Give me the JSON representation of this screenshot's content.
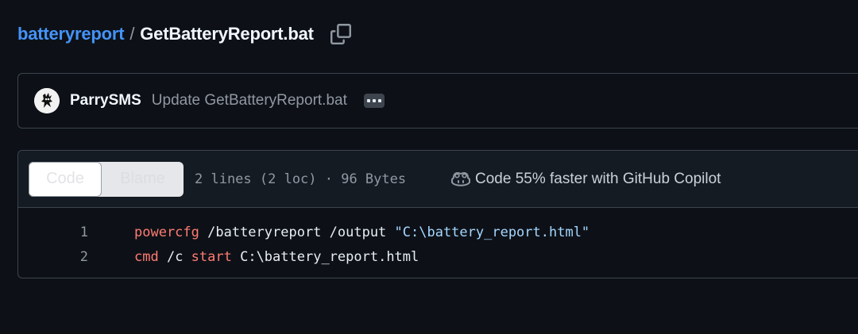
{
  "breadcrumb": {
    "repo": "batteryreport",
    "separator": "/",
    "file": "GetBatteryReport.bat",
    "copy_icon": "copy-icon"
  },
  "commit": {
    "author": "ParrySMS",
    "message": "Update GetBatteryReport.bat",
    "more_icon": "kebab-horizontal-icon"
  },
  "file_header": {
    "tabs": [
      "Code",
      "Blame"
    ],
    "active_tab": "Code",
    "info": "2 lines (2 loc) · 96 Bytes",
    "copilot_text": "Code 55% faster with GitHub Copilot",
    "copilot_icon": "copilot-icon"
  },
  "code": {
    "lines": [
      {
        "number": "1",
        "tokens": [
          {
            "text": "powercfg",
            "type": "kw"
          },
          {
            "text": " /batteryreport /output ",
            "type": "txt"
          },
          {
            "text": "\"C:\\battery_report.html\"",
            "type": "str"
          }
        ]
      },
      {
        "number": "2",
        "tokens": [
          {
            "text": "cmd",
            "type": "kw"
          },
          {
            "text": " /c ",
            "type": "txt"
          },
          {
            "text": "start",
            "type": "kw"
          },
          {
            "text": " C:\\battery_report.html",
            "type": "txt"
          }
        ]
      }
    ]
  },
  "colors": {
    "background": "#0d1117",
    "link": "#4493f8",
    "keyword": "#ff7b72",
    "string": "#a5d6ff",
    "muted": "#9198a1",
    "border": "#3d444d"
  }
}
